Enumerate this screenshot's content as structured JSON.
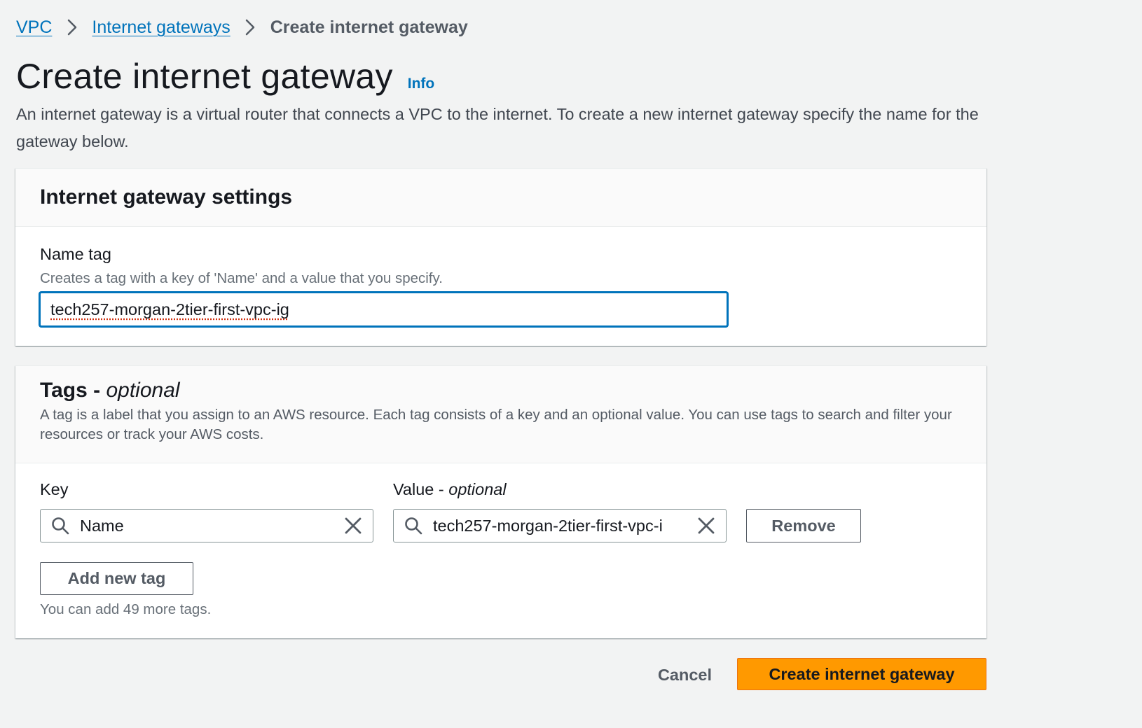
{
  "breadcrumb": {
    "items": [
      "VPC",
      "Internet gateways"
    ],
    "current": "Create internet gateway"
  },
  "header": {
    "title": "Create internet gateway",
    "info": "Info",
    "description": "An internet gateway is a virtual router that connects a VPC to the internet. To create a new internet gateway specify the name for the gateway below."
  },
  "settings": {
    "title": "Internet gateway settings",
    "name_tag_label": "Name tag",
    "name_tag_desc": "Creates a tag with a key of 'Name' and a value that you specify.",
    "name_tag_value": "tech257-morgan-2tier-first-vpc-ig"
  },
  "tags": {
    "title": "Tags - ",
    "title_optional": "optional",
    "description": "A tag is a label that you assign to an AWS resource. Each tag consists of a key and an optional value. You can use tags to search and filter your resources or track your AWS costs.",
    "key_label": "Key",
    "value_label": "Value - ",
    "value_optional": "optional",
    "key_value": "Name",
    "value_value": "tech257-morgan-2tier-first-vpc-i",
    "remove_label": "Remove",
    "add_label": "Add new tag",
    "limit_text": "You can add 49 more tags."
  },
  "footer": {
    "cancel_label": "Cancel",
    "create_label": "Create internet gateway"
  },
  "colors": {
    "link": "#0073bb",
    "primary": "#ff9900",
    "background": "#f2f3f3"
  }
}
